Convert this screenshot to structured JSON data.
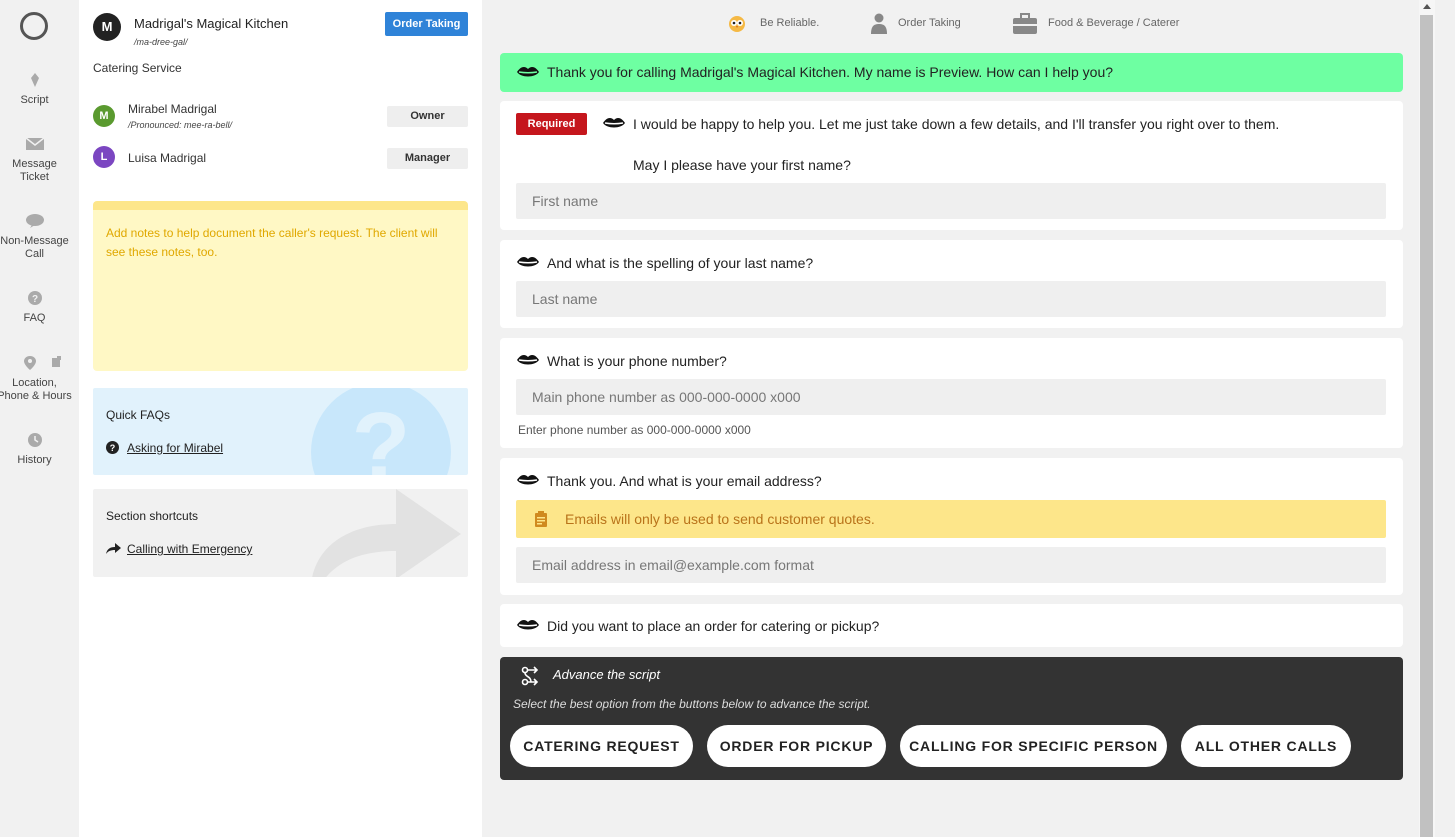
{
  "rail": {
    "items": [
      {
        "label": "Script",
        "icon": "script-icon"
      },
      {
        "label": "Message Ticket",
        "icon": "envelope-icon"
      },
      {
        "label": "Non-Message Call",
        "icon": "chat-bubble-icon"
      },
      {
        "label": "FAQ",
        "icon": "question-icon"
      },
      {
        "label": "Location, Phone & Hours",
        "icon": "location-pin-icon"
      },
      {
        "label": "History",
        "icon": "clock-icon"
      }
    ]
  },
  "business": {
    "avatar_letter": "M",
    "name": "Madrigal's Magical Kitchen",
    "pronunciation": "/ma-dree-gal/",
    "badge": "Order Taking",
    "category": "Catering Service"
  },
  "contacts": [
    {
      "initial": "M",
      "name": "Mirabel Madrigal",
      "pronunciation": "/Pronounced: mee-ra-bell/",
      "role": "Owner",
      "color": "#5a9a2f"
    },
    {
      "initial": "L",
      "name": "Luisa Madrigal",
      "pronunciation": "",
      "role": "Manager",
      "color": "#7b46c1"
    }
  ],
  "notes": {
    "placeholder": "Add notes to help document the caller's request. The client will see these notes, too."
  },
  "quick_faqs": {
    "title": "Quick FAQs",
    "items": [
      "Asking for Mirabel"
    ]
  },
  "section_shortcuts": {
    "title": "Section shortcuts",
    "items": [
      "Calling with Emergency"
    ]
  },
  "topnav": {
    "reliable": "Be Reliable.",
    "order": "Order Taking",
    "category": "Food & Beverage / Caterer"
  },
  "script": {
    "greeting": "Thank you for calling Madrigal's Magical Kitchen. My name is Preview. How can I help you?",
    "required_label": "Required",
    "first_intro": "I would be happy to help you. Let me just take down a few details, and I'll transfer you right over to them.",
    "first_question": "May I please have your first name?",
    "first_placeholder": "First name",
    "last_question": "And what is the spelling of your last name?",
    "last_placeholder": "Last name",
    "phone_question": "What is your phone number?",
    "phone_placeholder": "Main phone number as 000-000-0000 x000",
    "phone_hint": "Enter phone number as 000-000-0000 x000",
    "email_question": "Thank you. And what is your email address?",
    "email_warning": "Emails will only be used to send customer quotes.",
    "email_placeholder": "Email address in email@example.com format",
    "order_question": "Did you want to place an order for catering or pickup?"
  },
  "advance": {
    "title": "Advance the script",
    "subtitle": "Select the best option from the buttons below to advance the script.",
    "buttons": [
      "CATERING REQUEST",
      "ORDER FOR PICKUP",
      "CALLING FOR SPECIFIC PERSON",
      "ALL OTHER CALLS"
    ]
  },
  "colors": {
    "greeting_bg": "#6effa2",
    "required": "#c5161d",
    "badge_blue": "#2f83d8",
    "notes_bg": "#fff8c5",
    "warning_bg": "#fde68a",
    "advance_bg": "#333333"
  }
}
